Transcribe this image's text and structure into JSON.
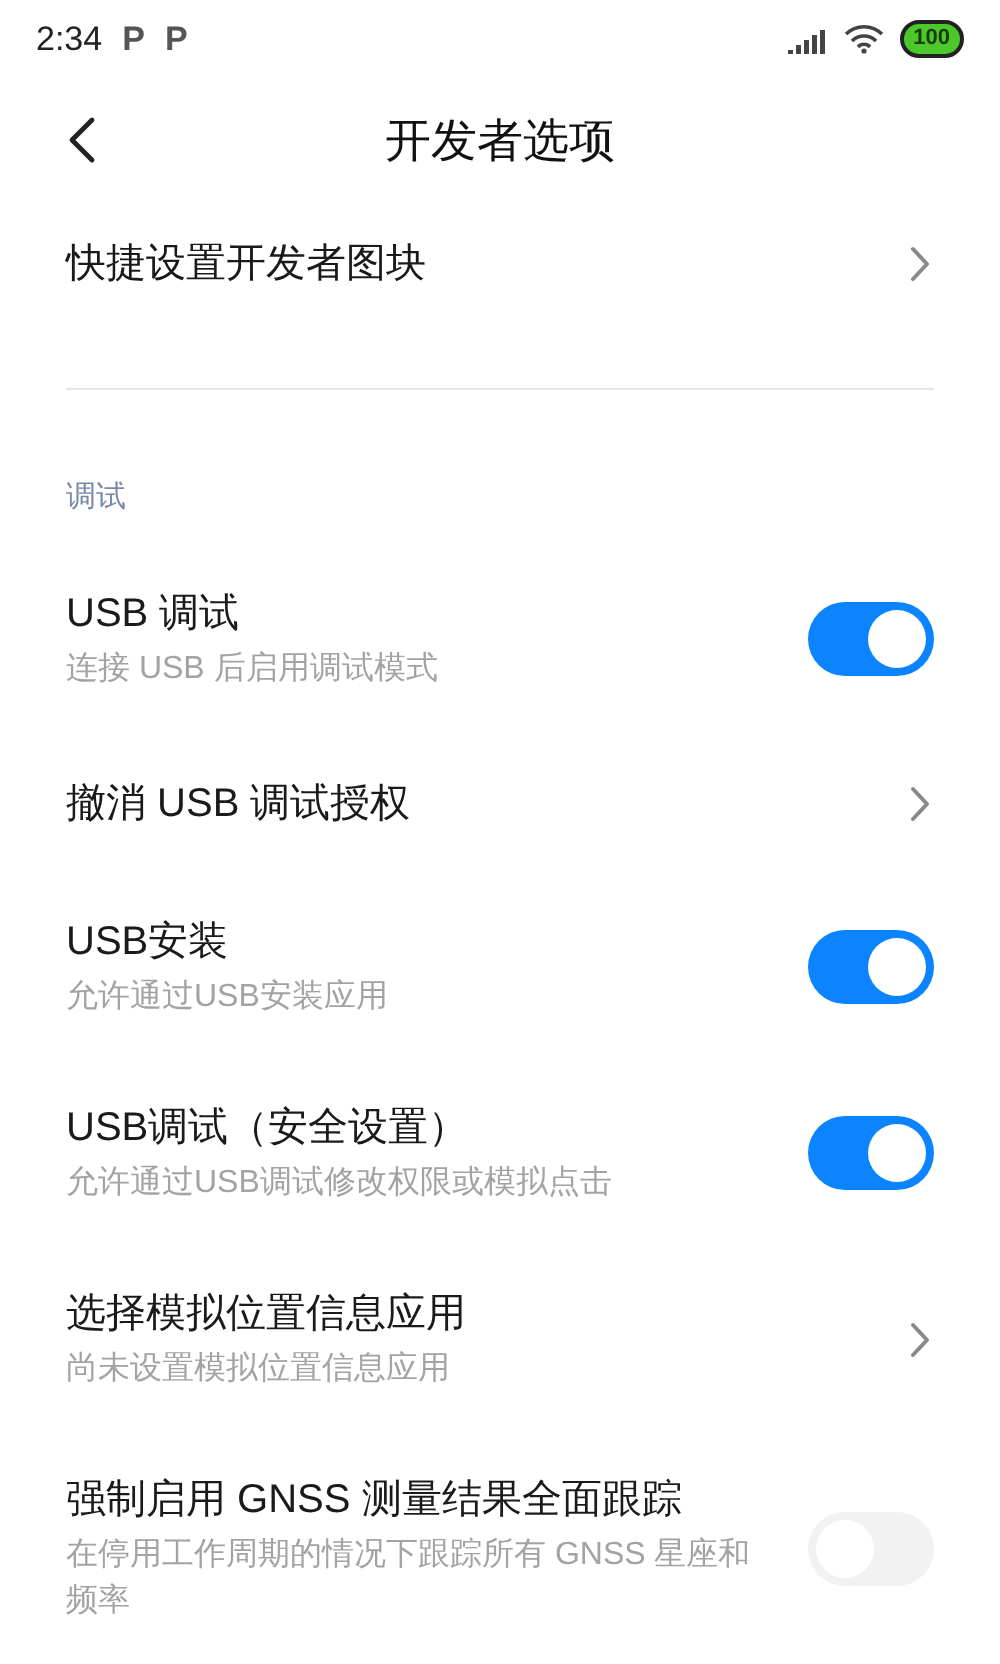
{
  "status_bar": {
    "time": "2:34",
    "notification_icons": [
      "P",
      "P"
    ],
    "battery": "100"
  },
  "header": {
    "title": "开发者选项"
  },
  "items": [
    {
      "kind": "link",
      "title": "快捷设置开发者图块"
    }
  ],
  "section": {
    "label": "调试"
  },
  "debug_items": [
    {
      "kind": "toggle",
      "title": "USB 调试",
      "subtitle": "连接 USB 后启用调试模式",
      "on": true
    },
    {
      "kind": "link",
      "title": "撤消 USB 调试授权"
    },
    {
      "kind": "toggle",
      "title": "USB安装",
      "subtitle": "允许通过USB安装应用",
      "on": true
    },
    {
      "kind": "toggle",
      "title": "USB调试（安全设置）",
      "subtitle": "允许通过USB调试修改权限或模拟点击",
      "on": true
    },
    {
      "kind": "link",
      "title": "选择模拟位置信息应用",
      "subtitle": "尚未设置模拟位置信息应用"
    },
    {
      "kind": "toggle",
      "title": "强制启用 GNSS 测量结果全面跟踪",
      "subtitle": "在停用工作周期的情况下跟踪所有 GNSS 星座和频率",
      "on": false
    }
  ]
}
